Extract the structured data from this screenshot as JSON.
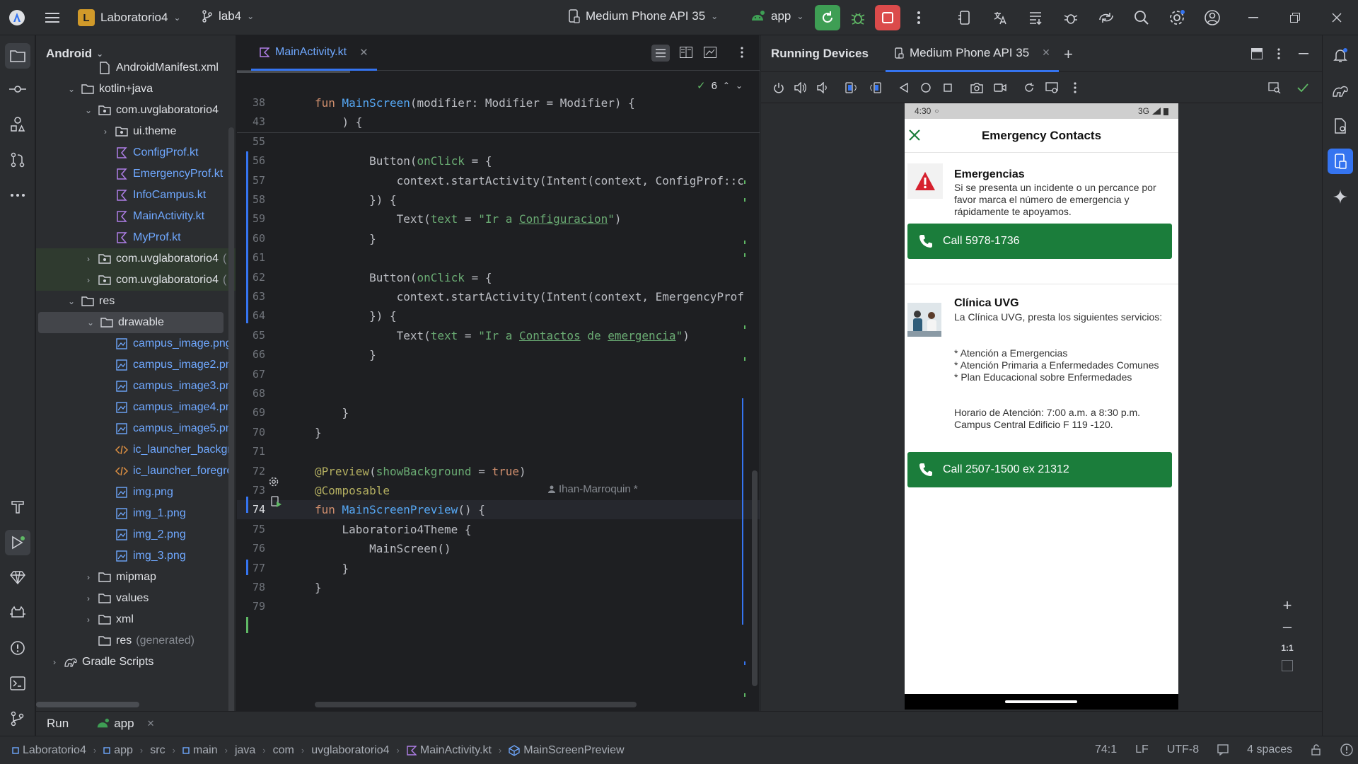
{
  "titlebar": {
    "project_initial": "L",
    "project_name": "Laboratorio4",
    "branch": "lab4",
    "device": "Medium Phone API 35",
    "run_config": "app"
  },
  "project_panel": {
    "view": "Android",
    "items": [
      {
        "label": "AndroidManifest.xml",
        "depth": 2,
        "kind": "file"
      },
      {
        "label": "kotlin+java",
        "depth": 1,
        "kind": "folder",
        "expanded": true
      },
      {
        "label": "com.uvglaboratorio4",
        "depth": 2,
        "kind": "package",
        "expanded": true
      },
      {
        "label": "ui.theme",
        "depth": 3,
        "kind": "package",
        "expanded": false
      },
      {
        "label": "ConfigProf.kt",
        "depth": 3,
        "kind": "kotlin"
      },
      {
        "label": "EmergencyProf.kt",
        "depth": 3,
        "kind": "kotlin"
      },
      {
        "label": "InfoCampus.kt",
        "depth": 3,
        "kind": "kotlin"
      },
      {
        "label": "MainActivity.kt",
        "depth": 3,
        "kind": "kotlin"
      },
      {
        "label": "MyProf.kt",
        "depth": 3,
        "kind": "kotlin"
      },
      {
        "label": "com.uvglaboratorio4",
        "suffix": "(",
        "depth": 2,
        "kind": "package",
        "expanded": false,
        "highlight": "green"
      },
      {
        "label": "com.uvglaboratorio4",
        "suffix": "(",
        "depth": 2,
        "kind": "package",
        "expanded": false,
        "highlight": "green"
      },
      {
        "label": "res",
        "depth": 1,
        "kind": "folder",
        "expanded": true
      },
      {
        "label": "drawable",
        "depth": 2,
        "kind": "folder",
        "expanded": true,
        "selected": true
      },
      {
        "label": "campus_image.png",
        "depth": 3,
        "kind": "image"
      },
      {
        "label": "campus_image2.pn",
        "depth": 3,
        "kind": "image"
      },
      {
        "label": "campus_image3.pn",
        "depth": 3,
        "kind": "image"
      },
      {
        "label": "campus_image4.pn",
        "depth": 3,
        "kind": "image"
      },
      {
        "label": "campus_image5.pn",
        "depth": 3,
        "kind": "image"
      },
      {
        "label": "ic_launcher_backgr",
        "depth": 3,
        "kind": "xml"
      },
      {
        "label": "ic_launcher_foregro",
        "depth": 3,
        "kind": "xml"
      },
      {
        "label": "img.png",
        "depth": 3,
        "kind": "image"
      },
      {
        "label": "img_1.png",
        "depth": 3,
        "kind": "image"
      },
      {
        "label": "img_2.png",
        "depth": 3,
        "kind": "image"
      },
      {
        "label": "img_3.png",
        "depth": 3,
        "kind": "image"
      },
      {
        "label": "mipmap",
        "depth": 2,
        "kind": "folder",
        "expanded": false
      },
      {
        "label": "values",
        "depth": 2,
        "kind": "folder",
        "expanded": false
      },
      {
        "label": "xml",
        "depth": 2,
        "kind": "folder",
        "expanded": false
      },
      {
        "label": "res",
        "suffix": "(generated)",
        "depth": 2,
        "kind": "folder"
      },
      {
        "label": "Gradle Scripts",
        "depth": 0,
        "kind": "gradle",
        "expanded": false
      }
    ]
  },
  "editor": {
    "tab": "MainActivity.kt",
    "inspection_count": "6",
    "author_hint": "Ihan-Marroquin *",
    "lines": [
      {
        "n": "38",
        "html": "<span class=\"kw\">fun</span> <span class=\"fn\">MainScreen</span>(modifier: Modifier = Modifier) {"
      },
      {
        "n": "43",
        "html": "    ) {"
      },
      {
        "n": "55",
        "html": ""
      },
      {
        "n": "56",
        "html": "        Button(<span class=\"par\">onClick</span> = {"
      },
      {
        "n": "57",
        "html": "            context.startActivity(Intent(context, ConfigProf::c"
      },
      {
        "n": "58",
        "html": "        }) {"
      },
      {
        "n": "59",
        "html": "            Text(<span class=\"par\">text</span> = <span class=\"str\">\"Ir a <span class=\"under\">Configuracion</span>\"</span>)"
      },
      {
        "n": "60",
        "html": "        }"
      },
      {
        "n": "61",
        "html": ""
      },
      {
        "n": "62",
        "html": "        Button(<span class=\"par\">onClick</span> = {"
      },
      {
        "n": "63",
        "html": "            context.startActivity(Intent(context, EmergencyProf"
      },
      {
        "n": "64",
        "html": "        }) {"
      },
      {
        "n": "65",
        "html": "            Text(<span class=\"par\">text</span> = <span class=\"str\">\"Ir a <span class=\"under\">Contactos</span> de <span class=\"under\">emergencia</span>\"</span>)"
      },
      {
        "n": "66",
        "html": "        }"
      },
      {
        "n": "67",
        "html": ""
      },
      {
        "n": "68",
        "html": ""
      },
      {
        "n": "69",
        "html": "    }"
      },
      {
        "n": "70",
        "html": "}"
      },
      {
        "n": "71",
        "html": ""
      },
      {
        "n": "72",
        "html": "<span class=\"ann\">@Preview</span>(<span class=\"par\">showBackground</span> = <span class=\"kw\">true</span>)"
      },
      {
        "n": "73",
        "html": "<span class=\"ann\">@Composable</span>"
      },
      {
        "n": "74",
        "html": "<span class=\"kw\">fun</span> <span class=\"fn\">MainScreenPreview</span>() {"
      },
      {
        "n": "75",
        "html": "    Laboratorio4Theme {"
      },
      {
        "n": "76",
        "html": "        MainScreen()"
      },
      {
        "n": "77",
        "html": "    }"
      },
      {
        "n": "78",
        "html": "}"
      },
      {
        "n": "79",
        "html": ""
      }
    ]
  },
  "devices": {
    "panel_title": "Running Devices",
    "tab": "Medium Phone API 35",
    "zoom_label": "1:1"
  },
  "phone": {
    "time": "4:30",
    "signal": "3G",
    "app_title": "Emergency Contacts",
    "card1": {
      "title": "Emergencias",
      "text": "Si se presenta un incidente o un percance por favor marca el número de emergencia y rápidamente te apoyamos.",
      "button": "Call 5978-1736"
    },
    "card2": {
      "title": "Clínica UVG",
      "text": "La Clínica UVG, presta los siguientes servicios:",
      "bullets": [
        "* Atención a Emergencias",
        "* Atención Primaria a Enfermedades Comunes",
        "* Plan Educacional sobre Enfermedades"
      ],
      "hours_line1": "Horario de Atención: 7:00 a.m. a 8:30 p.m.",
      "hours_line2": "Campus Central Edificio F 119 -120.",
      "button": "Call 2507-1500 ex 21312"
    }
  },
  "run": {
    "label": "Run",
    "config": "app"
  },
  "statusbar": {
    "crumbs": [
      "Laboratorio4",
      "app",
      "src",
      "main",
      "java",
      "com",
      "uvglaboratorio4",
      "MainActivity.kt",
      "MainScreenPreview"
    ],
    "position": "74:1",
    "line_sep": "LF",
    "encoding": "UTF-8",
    "indent": "4 spaces"
  },
  "colors": {
    "accent": "#3574f0",
    "run_green": "#3e9e54",
    "stop_red": "#db4b4b",
    "call_button": "#1b7d3b"
  }
}
